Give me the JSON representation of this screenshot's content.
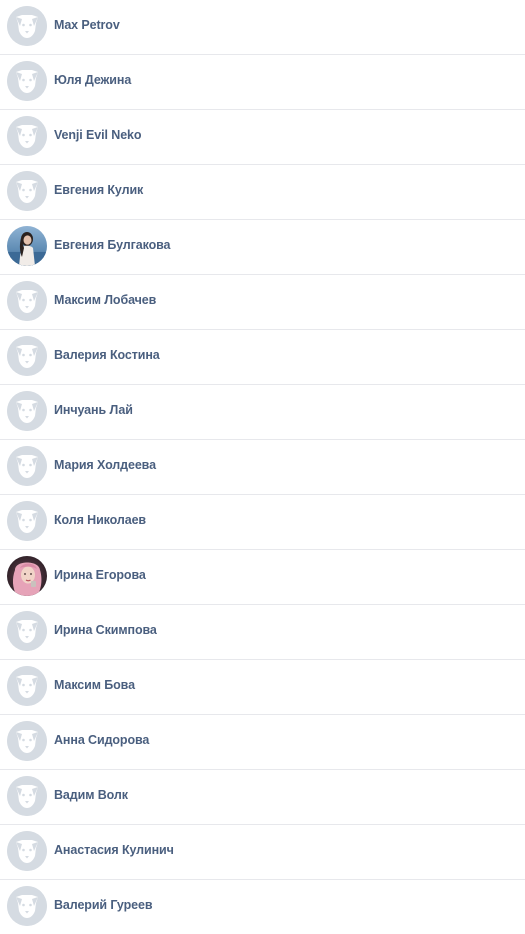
{
  "friends": [
    {
      "name": "Max Petrov",
      "avatar": "default-dog-icon"
    },
    {
      "name": "Юля Дежина",
      "avatar": "default-dog-icon"
    },
    {
      "name": "Venji Evil Neko",
      "avatar": "default-dog-icon"
    },
    {
      "name": "Евгения Кулик",
      "avatar": "default-dog-icon"
    },
    {
      "name": "Евгения Булгакова",
      "avatar": "photo"
    },
    {
      "name": "Максим Лобачев",
      "avatar": "default-dog-icon"
    },
    {
      "name": "Валерия Костина",
      "avatar": "default-dog-icon"
    },
    {
      "name": "Инчуань Лай",
      "avatar": "default-dog-icon"
    },
    {
      "name": "Мария Холдеева",
      "avatar": "default-dog-icon"
    },
    {
      "name": "Коля Николаев",
      "avatar": "default-dog-icon"
    },
    {
      "name": "Ирина Егорова",
      "avatar": "photo"
    },
    {
      "name": "Ирина Скимпова",
      "avatar": "default-dog-icon"
    },
    {
      "name": "Максим Бова",
      "avatar": "default-dog-icon"
    },
    {
      "name": "Анна Сидорова",
      "avatar": "default-dog-icon"
    },
    {
      "name": "Вадим Волк",
      "avatar": "default-dog-icon"
    },
    {
      "name": "Анастасия Кулинич",
      "avatar": "default-dog-icon"
    },
    {
      "name": "Валерий Гуреев",
      "avatar": "default-dog-icon"
    }
  ],
  "colors": {
    "name_text": "#4a5f7f",
    "divider": "#e7e8ec",
    "avatar_bg": "#d5dbe2",
    "avatar_icon": "#ffffff"
  }
}
